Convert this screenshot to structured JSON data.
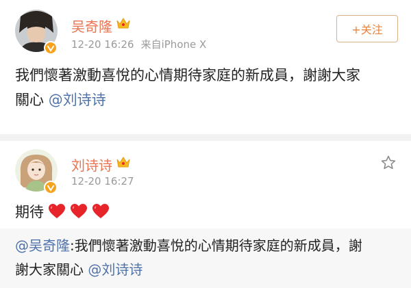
{
  "post1": {
    "username": "吴奇隆",
    "time": "12-20 16:26",
    "source": "来自iPhone X",
    "follow_label": "+关注",
    "content_line1": "我們懷著激動喜悅的心情期待家庭的新成員，謝謝大家",
    "content_line2_text": "關心 ",
    "content_mention": "@刘诗诗"
  },
  "post2": {
    "username": "刘诗诗",
    "time": "12-20 16:27",
    "content_text": "期待",
    "hearts": [
      "heart-icon",
      "heart-icon",
      "heart-icon"
    ]
  },
  "quote": {
    "line1_mention": "@吴奇隆",
    "line1_text": ":我們懷著激動喜悅的心情期待家庭的新成員，謝",
    "line2_text": "謝大家關心 ",
    "line2_mention": "@刘诗诗"
  },
  "colors": {
    "username": "#eb7350",
    "mention": "#4e72a9",
    "meta": "#9a9a9a",
    "badge": "#f7a21b",
    "heart": "#e8242b"
  }
}
